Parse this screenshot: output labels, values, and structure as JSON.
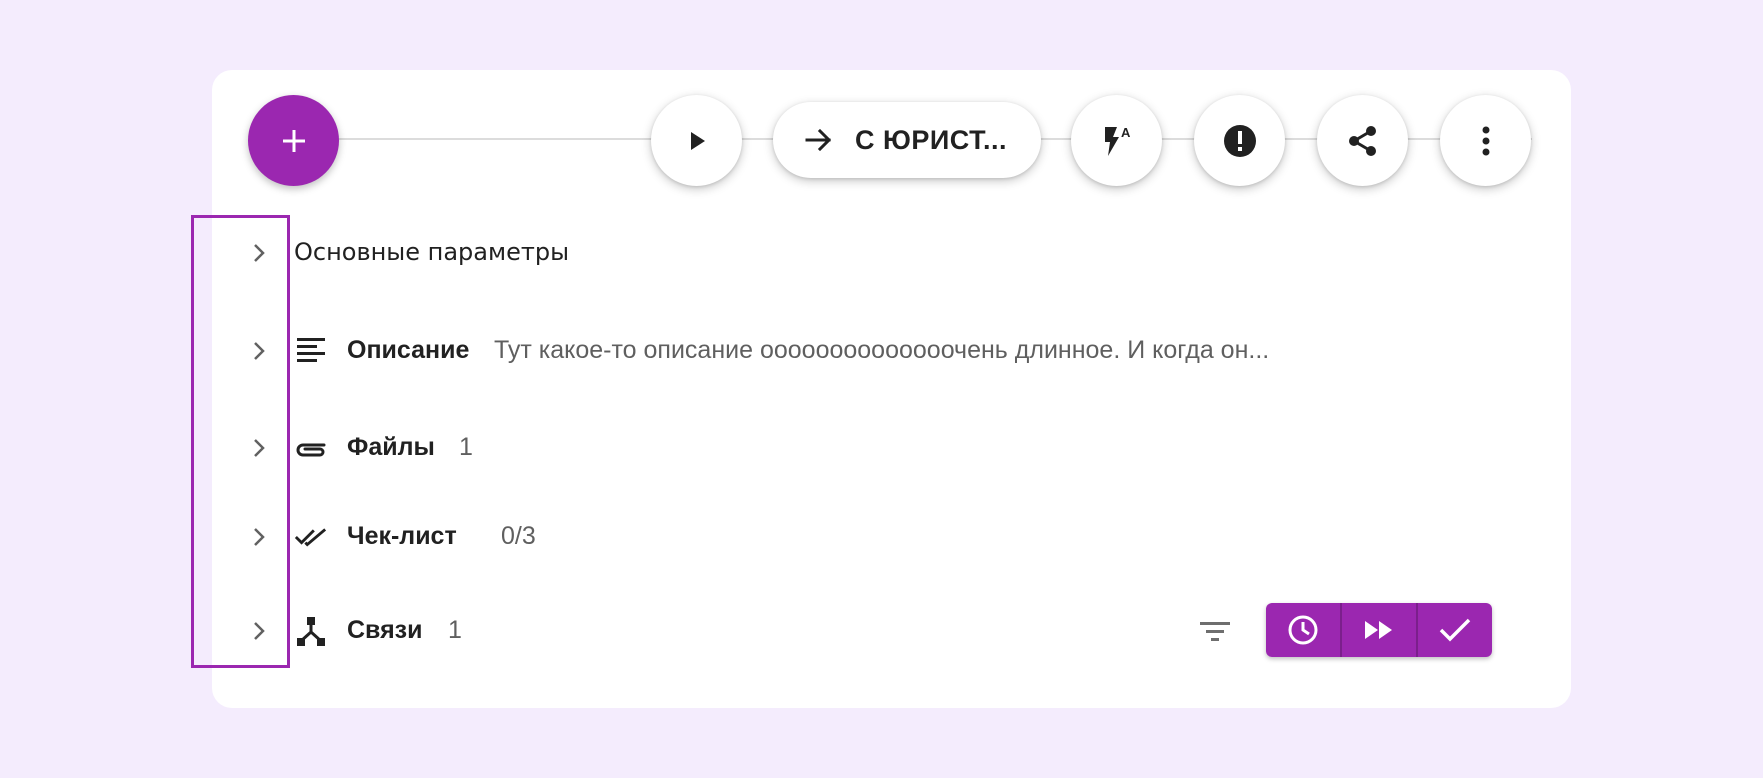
{
  "colors": {
    "page_background": "#f4ecfd",
    "card_background": "#ffffff",
    "accent": "#9b27b0",
    "text_primary": "#212121",
    "text_secondary": "#5f5f5f"
  },
  "toolbar": {
    "add_button_icon": "plus-icon",
    "start_button_icon": "play-icon",
    "status_button": {
      "icon": "arrow-right-icon",
      "label": "С ЮРИСТ..."
    },
    "automation_icon": "flash-auto-icon",
    "priority_icon": "alert-circle-icon",
    "share_icon": "share-icon",
    "more_icon": "more-vertical-icon"
  },
  "sections": [
    {
      "title": "Основные параметры",
      "icon": "",
      "value": ""
    },
    {
      "title": "Описание",
      "icon": "description-icon",
      "value": "Тут какое-то описание оооооооооооооочень длинное. И когда он..."
    },
    {
      "title": "Файлы",
      "icon": "paperclip-icon",
      "value": "1"
    },
    {
      "title": "Чек-лист",
      "icon": "double-check-icon",
      "value": "0/3"
    },
    {
      "title": "Связи",
      "icon": "links-icon",
      "value": "1"
    }
  ],
  "footer_actions": {
    "filter_icon": "filter-icon",
    "buttons": [
      "clock-icon",
      "fast-forward-icon",
      "check-icon"
    ]
  }
}
